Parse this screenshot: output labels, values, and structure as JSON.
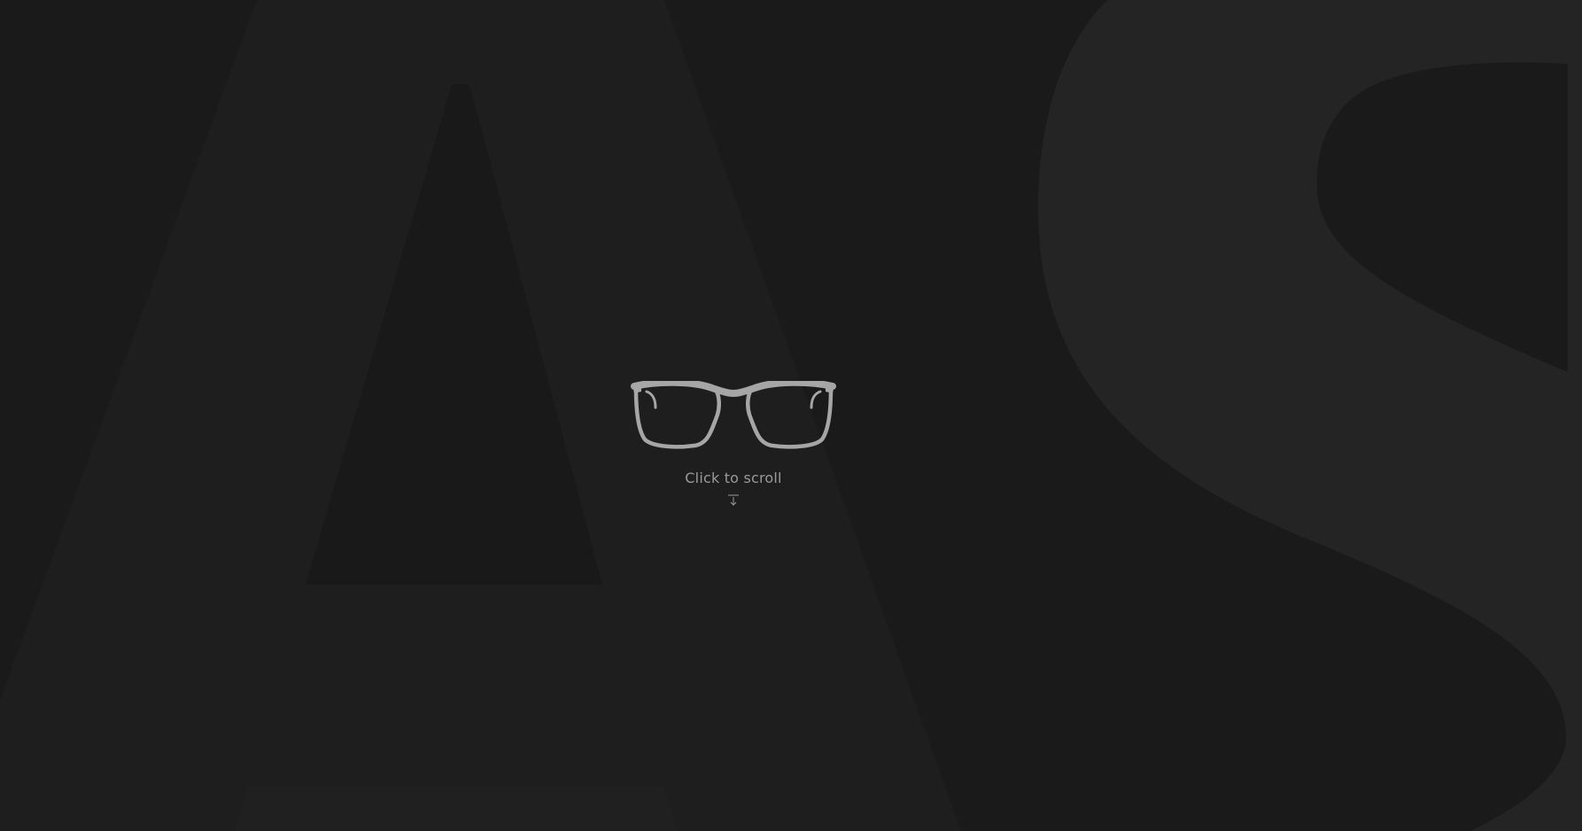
{
  "hero": {
    "background_letters": "AS",
    "logo_icon": "eyeglasses-icon",
    "scroll_label": "Click to scroll",
    "scroll_icon": "arrow-down-to-line-icon"
  },
  "colors": {
    "background": "#1a1a1a",
    "letter_a": "#1e1e1e",
    "letter_s": "#242424",
    "glasses": "#a6a6a6",
    "text": "#9a9a9a"
  }
}
